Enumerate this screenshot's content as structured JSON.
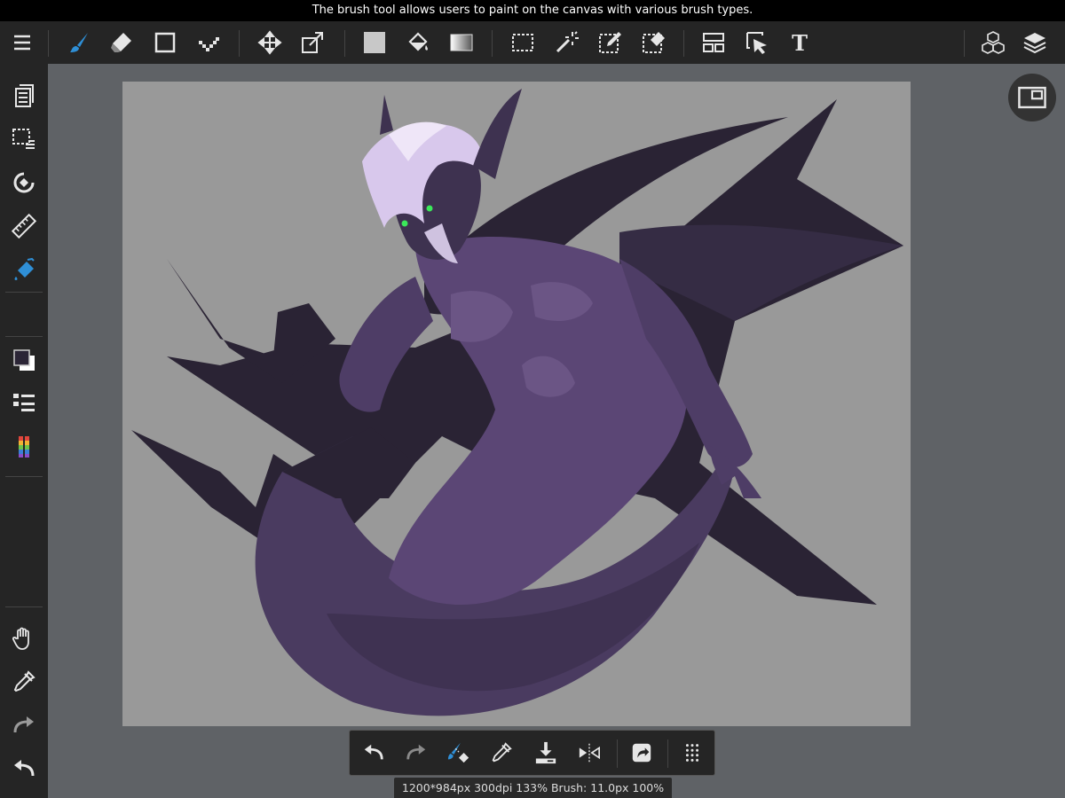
{
  "tooltip": "The brush tool allows users to paint on the canvas with various brush types.",
  "status_text": "1200*984px 300dpi 133% Brush: 11.0px 100%",
  "colors": {
    "accent": "#2f8fd6",
    "toolbar_bg": "#252525",
    "workspace_bg": "#5f6266",
    "canvas_bg": "#999999",
    "foreground_color": "#2b2536",
    "background_color": "#ffffff"
  },
  "toolbar": {
    "items": [
      {
        "name": "menu",
        "icon": "hamburger-icon"
      },
      {
        "name": "brush",
        "icon": "brush-icon",
        "active": true
      },
      {
        "name": "eraser",
        "icon": "eraser-icon"
      },
      {
        "name": "shape",
        "icon": "rectangle-icon"
      },
      {
        "name": "dot",
        "icon": "dot-pen-icon"
      },
      {
        "name": "move",
        "icon": "move-icon"
      },
      {
        "name": "transform",
        "icon": "transform-icon"
      },
      {
        "name": "fill-color",
        "icon": "fill-swatch-icon"
      },
      {
        "name": "bucket",
        "icon": "bucket-icon"
      },
      {
        "name": "gradient",
        "icon": "gradient-icon"
      },
      {
        "name": "select-rect",
        "icon": "select-rect-icon"
      },
      {
        "name": "magic-wand",
        "icon": "magic-wand-icon"
      },
      {
        "name": "select-pen",
        "icon": "select-pen-icon"
      },
      {
        "name": "select-eraser",
        "icon": "select-eraser-icon"
      },
      {
        "name": "frame-divider",
        "icon": "frame-icon"
      },
      {
        "name": "operation",
        "icon": "operation-cursor-icon"
      },
      {
        "name": "text",
        "icon": "text-icon",
        "label": "T"
      },
      {
        "name": "materials",
        "icon": "cubes-icon"
      },
      {
        "name": "layers",
        "icon": "layers-icon"
      }
    ]
  },
  "sidebar": {
    "items": [
      {
        "name": "brush-window",
        "icon": "brush-window-icon"
      },
      {
        "name": "selection-window",
        "icon": "selection-window-icon"
      },
      {
        "name": "snap",
        "icon": "snap-icon"
      },
      {
        "name": "ruler",
        "icon": "ruler-icon"
      },
      {
        "name": "fill-tool",
        "icon": "fill-tool-icon"
      },
      {
        "name": "color-swatch",
        "icon": "color-swatch-icon"
      },
      {
        "name": "layer-menu",
        "icon": "layer-list-icon"
      },
      {
        "name": "color-palette",
        "icon": "rainbow-palette-icon"
      },
      {
        "name": "hand",
        "icon": "hand-icon"
      },
      {
        "name": "eyedropper",
        "icon": "eyedropper-icon"
      },
      {
        "name": "redo",
        "icon": "redo-icon"
      },
      {
        "name": "undo",
        "icon": "undo-icon"
      }
    ]
  },
  "quickbar": {
    "items": [
      {
        "name": "undo",
        "icon": "undo-icon"
      },
      {
        "name": "redo",
        "icon": "redo-icon"
      },
      {
        "name": "brush-eraser-toggle",
        "icon": "brush-eraser-icon"
      },
      {
        "name": "eyedropper",
        "icon": "eyedropper-icon"
      },
      {
        "name": "save",
        "icon": "download-icon"
      },
      {
        "name": "flip",
        "icon": "flip-icon"
      },
      {
        "name": "share",
        "icon": "share-icon"
      },
      {
        "name": "more",
        "icon": "grid-dots-icon"
      }
    ]
  }
}
